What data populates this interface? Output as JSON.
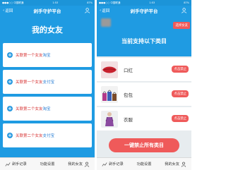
{
  "left": {
    "status": {
      "carrier": "●●●○○ 中国联通",
      "time": "1:53",
      "battery": "87%"
    },
    "nav": {
      "back": "返回",
      "title": "剁手守护平台"
    },
    "heading": "我的女友",
    "cards": [
      {
        "prefix": "关联第一个女友",
        "platform": "淘宝"
      },
      {
        "prefix": "关联第一个女友",
        "platform": "支付宝"
      },
      {
        "prefix": "关联第二个女友",
        "platform": "淘宝"
      },
      {
        "prefix": "关联第二个女友",
        "platform": "支付宝"
      }
    ],
    "tabs": [
      "剁手记录",
      "功能设置",
      "我的女友"
    ]
  },
  "right": {
    "status": {
      "carrier": "●●●○○ 中国联通",
      "time": "1:53",
      "battery": "87%"
    },
    "nav": {
      "back": "返回",
      "title": "剁手守护平台"
    },
    "switch_badge": "选择女友",
    "current_title": "当前支持以下类目",
    "items": [
      {
        "name": "口红",
        "action": "点击禁止"
      },
      {
        "name": "包包",
        "action": "点击禁止"
      },
      {
        "name": "衣服",
        "action": "点击禁止"
      }
    ],
    "ban_all": "一键禁止所有类目",
    "tabs": [
      "剁手记录",
      "功能设置",
      "我的女友"
    ]
  },
  "colors": {
    "primary_blue": "#1f9be2",
    "accent_red": "#ef5a5a",
    "text_red": "#d83a3a"
  }
}
